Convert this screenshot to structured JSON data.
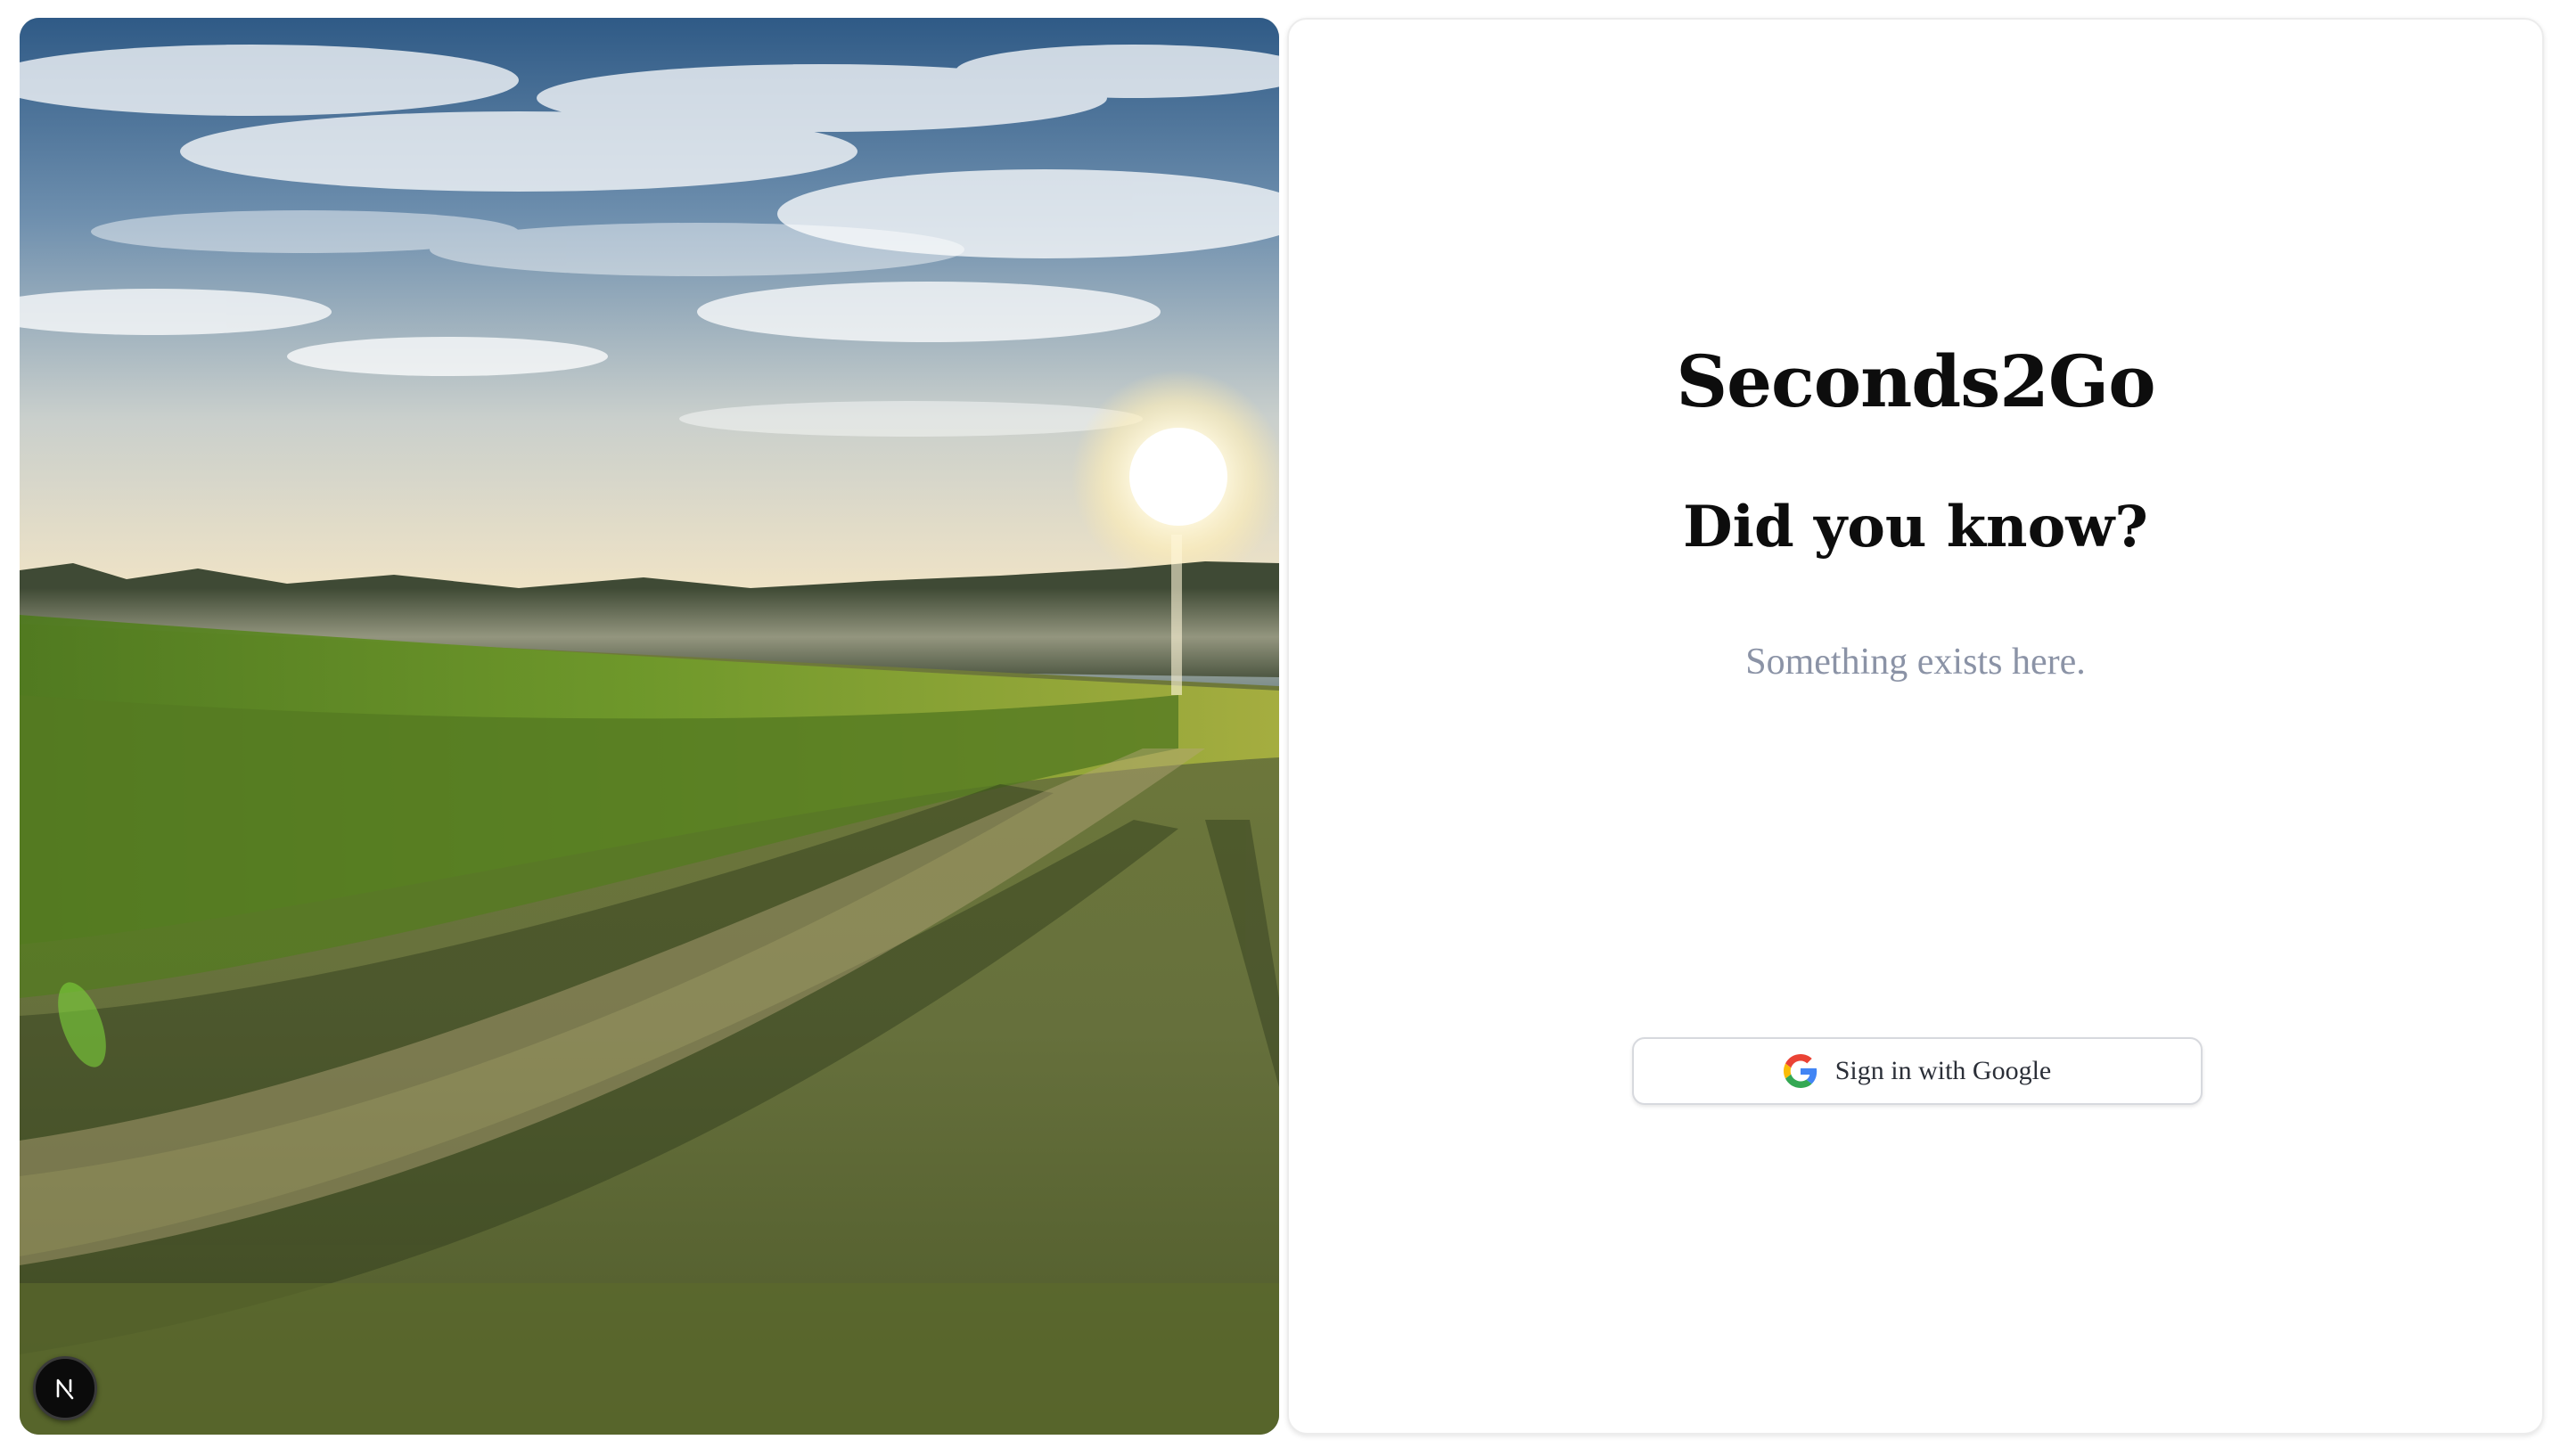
{
  "hero": {
    "image_alt": "Sunlit vineyard rows under a cloudy sky at sunrise",
    "icon": "nextjs-logo"
  },
  "login": {
    "app_title": "Seconds2Go",
    "fact_heading": "Did you know?",
    "fact_text": "Something exists here.",
    "google_button_label": "Sign in with Google",
    "google_icon": "google-g-icon"
  },
  "colors": {
    "title": "#0d0d0d",
    "fact_text": "#8b93a6",
    "button_border": "#d7d9de",
    "button_text": "#2b2f38",
    "google_blue": "#4285F4",
    "google_red": "#EA4335",
    "google_yellow": "#FBBC05",
    "google_green": "#34A853"
  }
}
